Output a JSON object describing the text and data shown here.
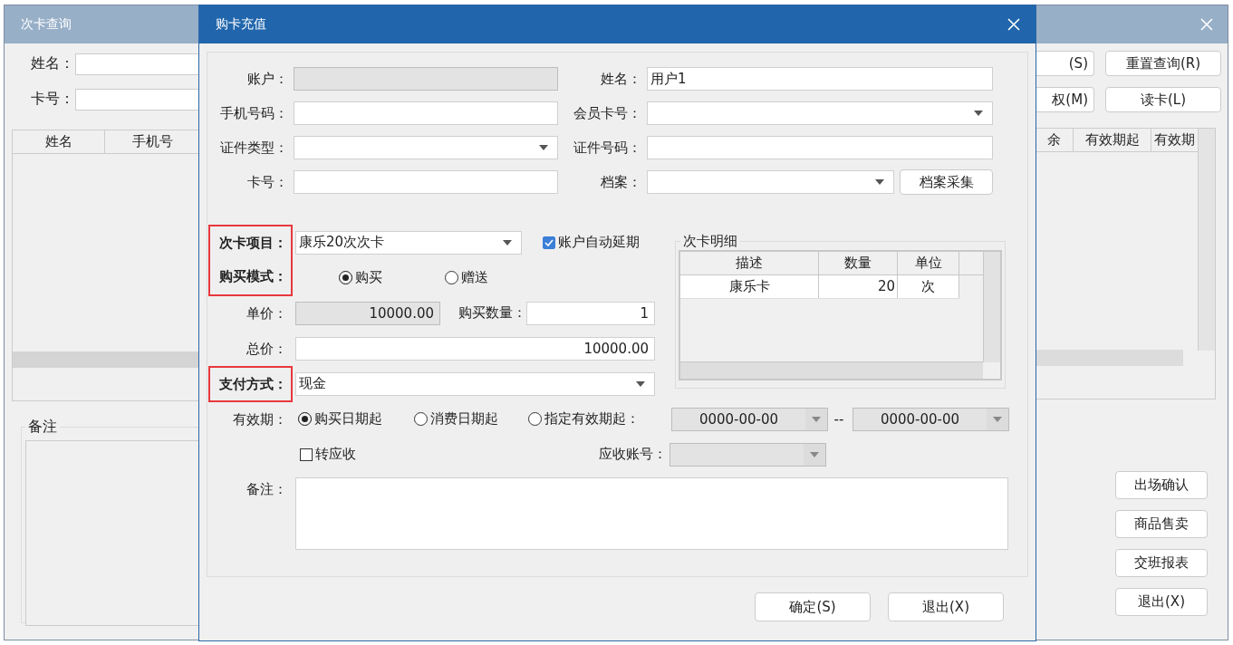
{
  "background_window": {
    "title": "次卡查询",
    "fields": [
      {
        "label": "姓名："
      },
      {
        "label": "卡号："
      }
    ],
    "left_table": {
      "columns": [
        "姓名",
        "手机号"
      ]
    },
    "remarks_group": {
      "title": "备注"
    },
    "top_buttons": [
      "(S)",
      "重置查询(R)",
      "权(M)",
      "读卡(L)"
    ],
    "right_table": {
      "columns": [
        "余",
        "有效期起",
        "有效期"
      ]
    },
    "side_buttons": [
      "出场确认",
      "商品售卖",
      "交班报表",
      "退出(X)"
    ]
  },
  "dialog": {
    "title": "购卡充值",
    "customer_fields": [
      {
        "label": "账户：",
        "kind": "text",
        "disabled": true
      },
      {
        "label": "姓名：",
        "kind": "text",
        "disabled": false,
        "value": "用户1"
      },
      {
        "label": "手机号码：",
        "kind": "text",
        "disabled": false
      },
      {
        "label": "会员卡号：",
        "kind": "combo",
        "disabled": false
      },
      {
        "label": "证件类型：",
        "kind": "combo",
        "disabled": false
      },
      {
        "label": "证件号码：",
        "kind": "text",
        "disabled": false
      },
      {
        "label": "卡号：",
        "kind": "text",
        "disabled": false
      },
      {
        "label": "档案：",
        "kind": "combo_button",
        "disabled": false,
        "button": "档案采集"
      }
    ],
    "card_item": {
      "label": "次卡项目：",
      "highlighted": true,
      "value": "康乐20次次卡"
    },
    "auto_extend": {
      "label": "账户自动延期",
      "checked": true
    },
    "purchase_mode": {
      "label": "购买模式：",
      "highlighted": true,
      "options": [
        {
          "label": "购买",
          "selected": true
        },
        {
          "label": "赠送",
          "selected": false
        }
      ]
    },
    "unit_price": {
      "label": "单价：",
      "value": "10000.00"
    },
    "quantity": {
      "label": "购买数量：",
      "value": "1"
    },
    "total": {
      "label": "总价：",
      "value": "10000.00"
    },
    "payment": {
      "label": "支付方式：",
      "highlighted": true,
      "value": "现金"
    },
    "detail_group": {
      "title": "次卡明细",
      "columns": [
        "描述",
        "数量",
        "单位"
      ],
      "rows": [
        [
          "康乐卡",
          "20",
          "次"
        ]
      ]
    },
    "validity": {
      "label": "有效期：",
      "options": [
        {
          "label": "购买日期起",
          "selected": true
        },
        {
          "label": "消费日期起",
          "selected": false
        },
        {
          "label": "指定有效期起：",
          "selected": false
        }
      ],
      "date_from": "0000-00-00",
      "separator": "--",
      "date_to": "0000-00-00"
    },
    "transfer": {
      "label": "转应收",
      "checked": false
    },
    "receivable_account": {
      "label": "应收账号："
    },
    "remarks": {
      "label": "备注："
    },
    "buttons": [
      "确定(S)",
      "退出(X)"
    ]
  }
}
